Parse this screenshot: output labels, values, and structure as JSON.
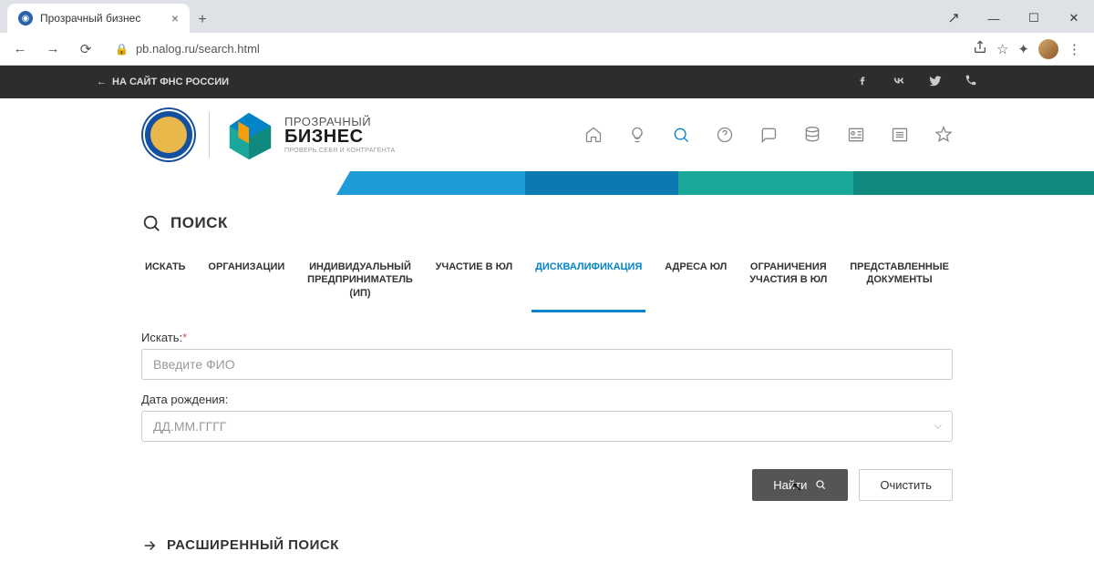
{
  "browser": {
    "tab_title": "Прозрачный бизнес",
    "url": "pb.nalog.ru/search.html"
  },
  "topbar": {
    "back_link": "НА САЙТ ФНС РОССИИ"
  },
  "logo": {
    "line1": "ПРОЗРАЧНЫЙ",
    "line2": "БИЗНЕС",
    "line3": "ПРОВЕРЬ СЕБЯ И КОНТРАГЕНТА"
  },
  "nav_icons": [
    "home",
    "idea",
    "search",
    "help",
    "chat",
    "db",
    "card",
    "list",
    "star"
  ],
  "search": {
    "title": "ПОИСК",
    "tabs": [
      {
        "label": "ИСКАТЬ"
      },
      {
        "label": "ОРГАНИЗАЦИИ"
      },
      {
        "label": "ИНДИВИДУАЛЬНЫЙ\nПРЕДПРИНИМАТЕЛЬ\n(ИП)"
      },
      {
        "label": "УЧАСТИЕ В ЮЛ"
      },
      {
        "label": "ДИСКВАЛИФИКАЦИЯ",
        "active": true
      },
      {
        "label": "АДРЕСА ЮЛ"
      },
      {
        "label": "ОГРАНИЧЕНИЯ\nУЧАСТИЯ В ЮЛ"
      },
      {
        "label": "ПРЕДСТАВЛЕННЫЕ\nДОКУМЕНТЫ"
      }
    ],
    "field1": {
      "label": "Искать:",
      "placeholder": "Введите ФИО",
      "required": true
    },
    "field2": {
      "label": "Дата рождения:",
      "placeholder": "ДД.ММ.ГГГГ"
    },
    "submit": "Найти",
    "clear": "Очистить",
    "advanced": "РАСШИРЕННЫЙ ПОИСК"
  }
}
